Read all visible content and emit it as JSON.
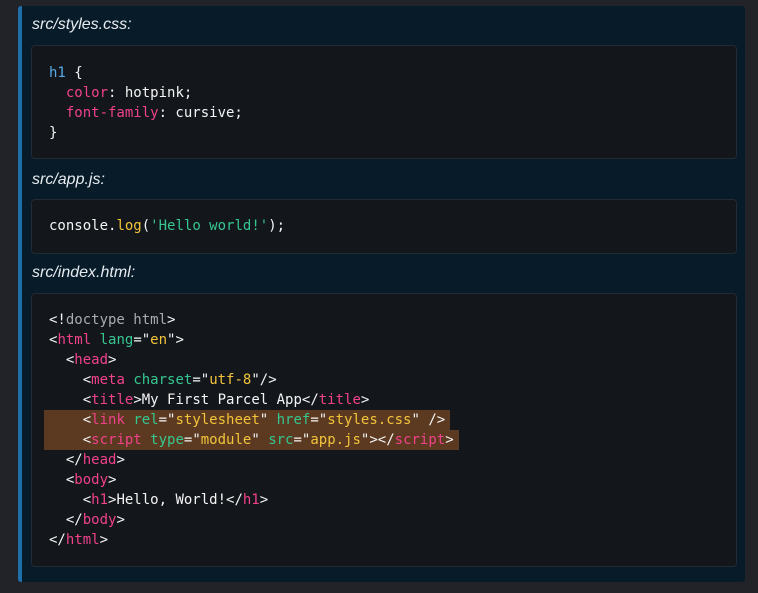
{
  "files": [
    {
      "label": "src/styles.css:",
      "lines": [
        [
          {
            "t": "h1",
            "c": "sel"
          },
          {
            "t": " {",
            "c": "text"
          }
        ],
        [
          {
            "t": "  ",
            "c": "text"
          },
          {
            "t": "color",
            "c": "prop"
          },
          {
            "t": ": hotpink;",
            "c": "text"
          }
        ],
        [
          {
            "t": "  ",
            "c": "text"
          },
          {
            "t": "font-family",
            "c": "prop"
          },
          {
            "t": ": cursive;",
            "c": "text"
          }
        ],
        [
          {
            "t": "}",
            "c": "text"
          }
        ]
      ]
    },
    {
      "label": "src/app.js:",
      "lines": [
        [
          {
            "t": "console.",
            "c": "text"
          },
          {
            "t": "log",
            "c": "fn"
          },
          {
            "t": "(",
            "c": "text"
          },
          {
            "t": "'Hello world!'",
            "c": "qstr"
          },
          {
            "t": ");",
            "c": "text"
          }
        ]
      ]
    },
    {
      "label": "src/index.html:",
      "lines": [
        [
          {
            "t": "<!",
            "c": "text"
          },
          {
            "t": "doctype html",
            "c": "doct"
          },
          {
            "t": ">",
            "c": "text"
          }
        ],
        [
          {
            "t": "<",
            "c": "text"
          },
          {
            "t": "html",
            "c": "tag"
          },
          {
            "t": " ",
            "c": "text"
          },
          {
            "t": "lang",
            "c": "attr"
          },
          {
            "t": "=\"",
            "c": "text"
          },
          {
            "t": "en",
            "c": "str"
          },
          {
            "t": "\">",
            "c": "text"
          }
        ],
        [
          {
            "t": "  <",
            "c": "text"
          },
          {
            "t": "head",
            "c": "tag"
          },
          {
            "t": ">",
            "c": "text"
          }
        ],
        [
          {
            "t": "    <",
            "c": "text"
          },
          {
            "t": "meta",
            "c": "tag"
          },
          {
            "t": " ",
            "c": "text"
          },
          {
            "t": "charset",
            "c": "attr"
          },
          {
            "t": "=\"",
            "c": "text"
          },
          {
            "t": "utf-8",
            "c": "str"
          },
          {
            "t": "\"/>",
            "c": "text"
          }
        ],
        [
          {
            "t": "    <",
            "c": "text"
          },
          {
            "t": "title",
            "c": "tag"
          },
          {
            "t": ">My First Parcel App</",
            "c": "text"
          },
          {
            "t": "title",
            "c": "tag"
          },
          {
            "t": ">",
            "c": "text"
          }
        ],
        {
          "highlight": true,
          "tokens": [
            {
              "t": "    <",
              "c": "text"
            },
            {
              "t": "link",
              "c": "tag"
            },
            {
              "t": " ",
              "c": "text"
            },
            {
              "t": "rel",
              "c": "attr"
            },
            {
              "t": "=\"",
              "c": "text"
            },
            {
              "t": "stylesheet",
              "c": "str"
            },
            {
              "t": "\" ",
              "c": "text"
            },
            {
              "t": "href",
              "c": "attr"
            },
            {
              "t": "=\"",
              "c": "text"
            },
            {
              "t": "styles.css",
              "c": "str"
            },
            {
              "t": "\" />",
              "c": "text"
            }
          ]
        },
        {
          "highlight": true,
          "tokens": [
            {
              "t": "    <",
              "c": "text"
            },
            {
              "t": "script",
              "c": "tag"
            },
            {
              "t": " ",
              "c": "text"
            },
            {
              "t": "type",
              "c": "attr"
            },
            {
              "t": "=\"",
              "c": "text"
            },
            {
              "t": "module",
              "c": "str"
            },
            {
              "t": "\" ",
              "c": "text"
            },
            {
              "t": "src",
              "c": "attr"
            },
            {
              "t": "=\"",
              "c": "text"
            },
            {
              "t": "app.js",
              "c": "str"
            },
            {
              "t": "\"></",
              "c": "text"
            },
            {
              "t": "script",
              "c": "tag"
            },
            {
              "t": ">",
              "c": "text"
            }
          ]
        },
        [
          {
            "t": "  </",
            "c": "text"
          },
          {
            "t": "head",
            "c": "tag"
          },
          {
            "t": ">",
            "c": "text"
          }
        ],
        [
          {
            "t": "  <",
            "c": "text"
          },
          {
            "t": "body",
            "c": "tag"
          },
          {
            "t": ">",
            "c": "text"
          }
        ],
        [
          {
            "t": "    <",
            "c": "text"
          },
          {
            "t": "h1",
            "c": "tag"
          },
          {
            "t": ">Hello, World!</",
            "c": "text"
          },
          {
            "t": "h1",
            "c": "tag"
          },
          {
            "t": ">",
            "c": "text"
          }
        ],
        [
          {
            "t": "  </",
            "c": "text"
          },
          {
            "t": "body",
            "c": "tag"
          },
          {
            "t": ">",
            "c": "text"
          }
        ],
        [
          {
            "t": "</",
            "c": "text"
          },
          {
            "t": "html",
            "c": "tag"
          },
          {
            "t": ">",
            "c": "text"
          }
        ]
      ]
    }
  ]
}
